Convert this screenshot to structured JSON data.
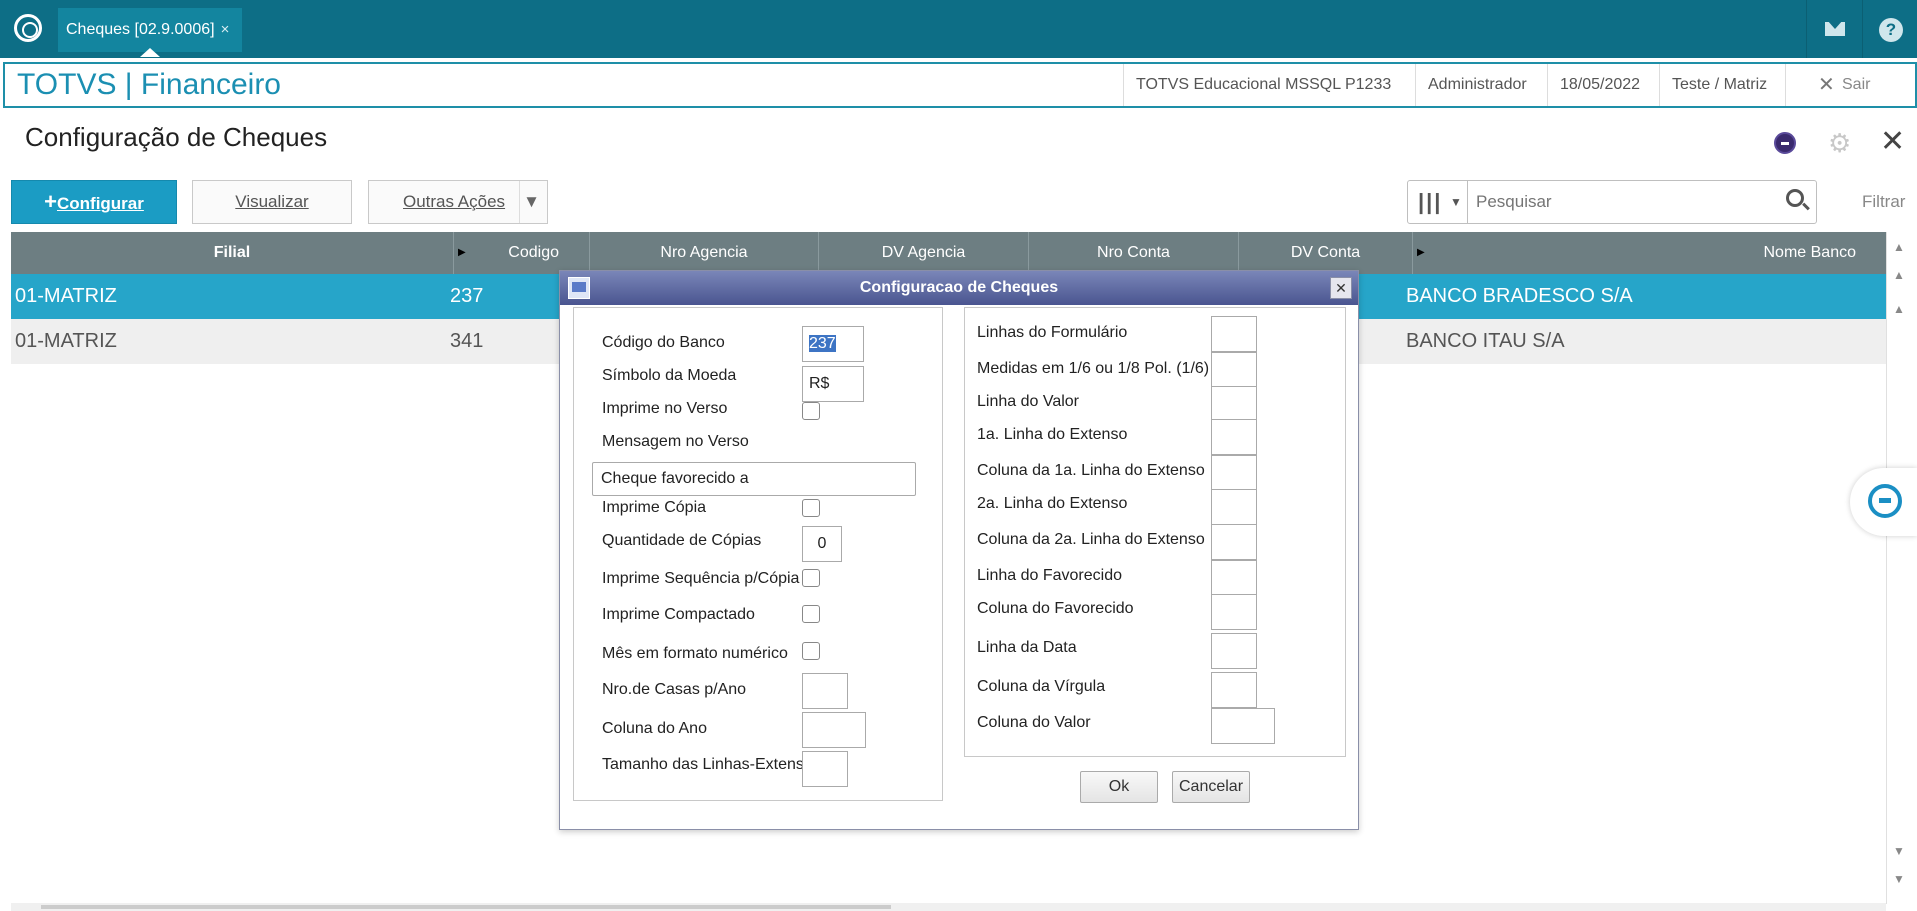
{
  "topbar": {
    "tab_label": "Cheques [02.9.0006]",
    "tab_close": "×"
  },
  "header": {
    "brand": "TOTVS | Financeiro",
    "environment": "TOTVS Educacional MSSQL P1233",
    "user": "Administrador",
    "date": "18/05/2022",
    "branch": "Teste / Matriz",
    "logout": "Sair"
  },
  "page": {
    "title": "Configuração de Cheques"
  },
  "toolbar": {
    "configure": "Configurar",
    "view": "Visualizar",
    "more": "Outras Ações",
    "search_placeholder": "Pesquisar",
    "filter": "Filtrar"
  },
  "grid": {
    "columns": [
      "Filial",
      "Codigo",
      "Nro Agencia",
      "DV Agencia",
      "Nro Conta",
      "DV Conta",
      "Nome Banco"
    ],
    "rows": [
      {
        "filial": "01-MATRIZ",
        "codigo": "237",
        "nome_banco": "BANCO BRADESCO S/A"
      },
      {
        "filial": "01-MATRIZ",
        "codigo": "341",
        "nome_banco": "BANCO ITAU S/A"
      }
    ]
  },
  "dialog": {
    "title": "Configuracao de Cheques",
    "left": {
      "codigo_banco_label": "Código do Banco",
      "codigo_banco_value": "237",
      "simbolo_moeda_label": "Símbolo da Moeda",
      "simbolo_moeda_value": "R$",
      "imprime_verso_label": "Imprime no Verso",
      "mensagem_verso_label": "Mensagem no Verso",
      "mensagem_verso_value": "Cheque favorecido a",
      "imprime_copia_label": "Imprime Cópia",
      "qtd_copias_label": "Quantidade de Cópias",
      "qtd_copias_value": "0",
      "imprime_sequencia_label": "Imprime Sequência p/Cópia",
      "imprime_compactado_label": "Imprime Compactado",
      "mes_numerico_label": "Mês em formato numérico",
      "casas_ano_label": "Nro.de Casas p/Ano",
      "coluna_ano_label": "Coluna do Ano",
      "tamanho_linhas_label": "Tamanho das Linhas-Extenso"
    },
    "right": {
      "linhas_formulario": "Linhas do Formulário",
      "medidas": "Medidas em 1/6 ou 1/8 Pol. (1/6)",
      "linha_valor": "Linha do Valor",
      "linha1_extenso": "1a. Linha do Extenso",
      "coluna1_extenso": "Coluna da 1a. Linha do Extenso",
      "linha2_extenso": "2a. Linha do Extenso",
      "coluna2_extenso": "Coluna da 2a. Linha do Extenso",
      "linha_favorecido": "Linha do Favorecido",
      "coluna_favorecido": "Coluna do Favorecido",
      "linha_data": "Linha da Data",
      "coluna_virgula": "Coluna da Vírgula",
      "coluna_valor": "Coluna do Valor"
    },
    "ok": "Ok",
    "cancel": "Cancelar"
  }
}
